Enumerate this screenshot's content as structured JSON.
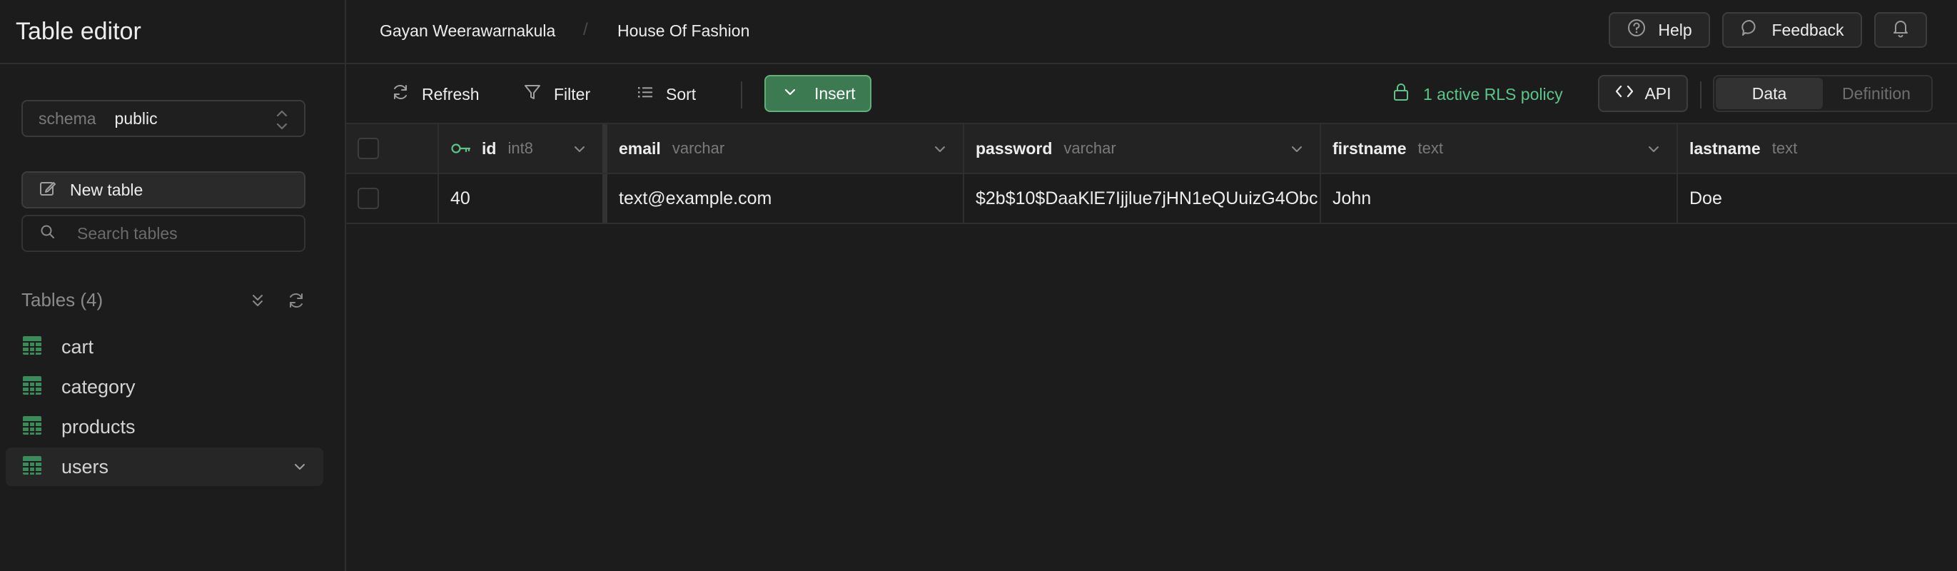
{
  "sidebar": {
    "title": "Table editor",
    "schema": {
      "label": "schema",
      "value": "public"
    },
    "new_table_label": "New table",
    "search_placeholder": "Search tables",
    "tables_title": "Tables (4)",
    "tables": [
      {
        "name": "cart",
        "active": false
      },
      {
        "name": "category",
        "active": false
      },
      {
        "name": "products",
        "active": false
      },
      {
        "name": "users",
        "active": true
      }
    ]
  },
  "breadcrumb": {
    "org": "Gayan Weerawarnakula",
    "separator": "/",
    "project": "House Of Fashion"
  },
  "header_actions": {
    "help": "Help",
    "feedback": "Feedback"
  },
  "toolbar": {
    "refresh": "Refresh",
    "filter": "Filter",
    "sort": "Sort",
    "insert": "Insert",
    "rls": "1 active RLS policy",
    "api": "API",
    "views": [
      "Data",
      "Definition"
    ],
    "active_view": "Data"
  },
  "grid": {
    "columns": [
      {
        "name": "id",
        "type": "int8",
        "primary_key": true
      },
      {
        "name": "email",
        "type": "varchar"
      },
      {
        "name": "password",
        "type": "varchar"
      },
      {
        "name": "firstname",
        "type": "text"
      },
      {
        "name": "lastname",
        "type": "text"
      }
    ],
    "rows": [
      {
        "id": "40",
        "email": "text@example.com",
        "password": "$2b$10$DaaKlE7Ijjlue7jHN1eQUuizG4Obc",
        "firstname": "John",
        "lastname": "Doe"
      }
    ]
  },
  "colors": {
    "background": "#1c1c1c",
    "border": "#2e2e2e",
    "accent_green": "#3c7a52",
    "rls_green": "#5cc58a"
  }
}
